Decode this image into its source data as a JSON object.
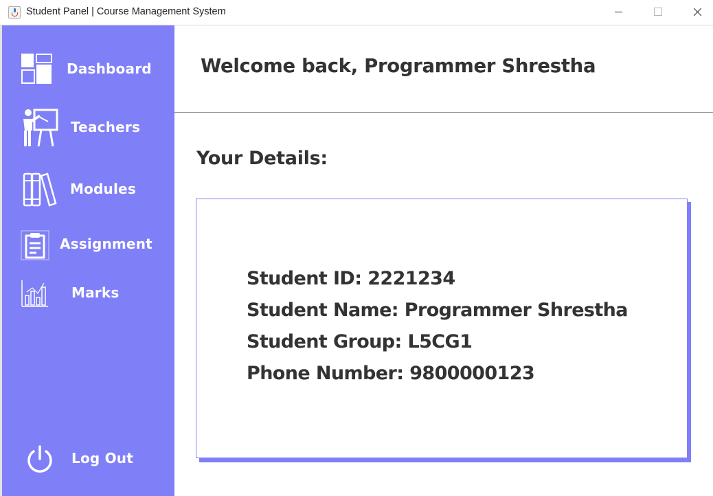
{
  "window": {
    "title": "Student Panel | Course Management System",
    "app_icon": "java-cup-icon"
  },
  "sidebar": {
    "background_color": "#7F7FF8",
    "items": [
      {
        "label": "Dashboard",
        "icon": "dashboard-grid-icon"
      },
      {
        "label": "Teachers",
        "icon": "teacher-whiteboard-icon"
      },
      {
        "label": "Modules",
        "icon": "books-icon"
      },
      {
        "label": "Assignment",
        "icon": "clipboard-icon"
      },
      {
        "label": "Marks",
        "icon": "bar-chart-icon"
      }
    ],
    "logout": {
      "label": "Log Out",
      "icon": "power-icon"
    }
  },
  "header": {
    "welcome": "Welcome back, Programmer Shrestha"
  },
  "details": {
    "title": "Your Details:",
    "lines": [
      "Student ID: 2221234",
      "Student Name: Programmer Shrestha",
      "Student Group: L5CG1",
      "Phone Number: 9800000123"
    ]
  }
}
